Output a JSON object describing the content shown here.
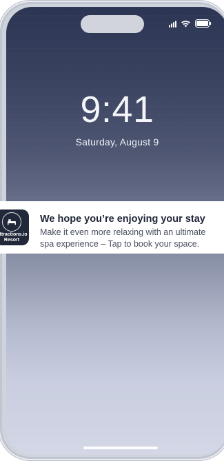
{
  "lock_screen": {
    "time": "9:41",
    "date": "Saturday, August 9"
  },
  "status_bar": {
    "signal_icon": "cellular-signal-icon",
    "wifi_icon": "wifi-icon",
    "battery_icon": "battery-icon"
  },
  "notification": {
    "app_icon": {
      "line1": "Attractions.io",
      "line2": "Resort",
      "icon": "bed-icon"
    },
    "title": "We hope you’re enjoying your stay",
    "body": "Make it even more relaxing with an ultimate spa experience  – Tap to book your space."
  },
  "colors": {
    "banner_background": "#ffffff",
    "app_icon_background": "#21283a",
    "title_text": "#1e2536",
    "body_text": "#4a5062"
  }
}
